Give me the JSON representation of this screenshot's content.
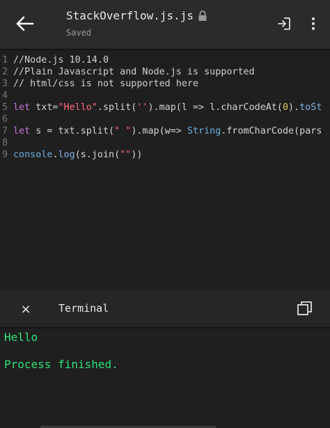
{
  "appbar": {
    "title": "StackOverflow.js.js",
    "subtitle": "Saved"
  },
  "editor": {
    "lines": [
      {
        "n": "1",
        "text": "//Node.js 10.14.0"
      },
      {
        "n": "2",
        "text": "//Plain Javascript and Node.js is supported"
      },
      {
        "n": "3",
        "text": "// html/css is not supported here"
      },
      {
        "n": "4",
        "text": ""
      },
      {
        "n": "5",
        "text": "let txt=\"Hello\".split('').map(l => l.charCodeAt(0).toSt"
      },
      {
        "n": "6",
        "text": ""
      },
      {
        "n": "7",
        "text": "let s = txt.split(\" \").map(w=> String.fromCharCode(pars"
      },
      {
        "n": "8",
        "text": ""
      },
      {
        "n": "9",
        "text": "console.log(s.join(\"\"))"
      }
    ],
    "tokens": {
      "l5": [
        "let",
        " txt=",
        "\"Hello\"",
        ".split(",
        "''",
        ").map(l => l.charCodeAt(",
        "0",
        ").",
        "toSt"
      ],
      "l7": [
        "let",
        " s = txt.split(",
        "\" \"",
        ").map(w=> ",
        "String",
        ".fromCharCode(pars"
      ],
      "l9": [
        "console",
        ".",
        "log",
        "(s.join(",
        "\"\"",
        "))"
      ]
    }
  },
  "terminal": {
    "title": "Terminal",
    "close_glyph": "×",
    "output": [
      "Hello",
      "Process finished."
    ]
  },
  "colors": {
    "accent": "#2ecc71",
    "output": "#2fe07a",
    "keyword": "#c678dd",
    "string": "#ff6b7a",
    "number": "#e0c060",
    "type": "#6ab0de"
  }
}
